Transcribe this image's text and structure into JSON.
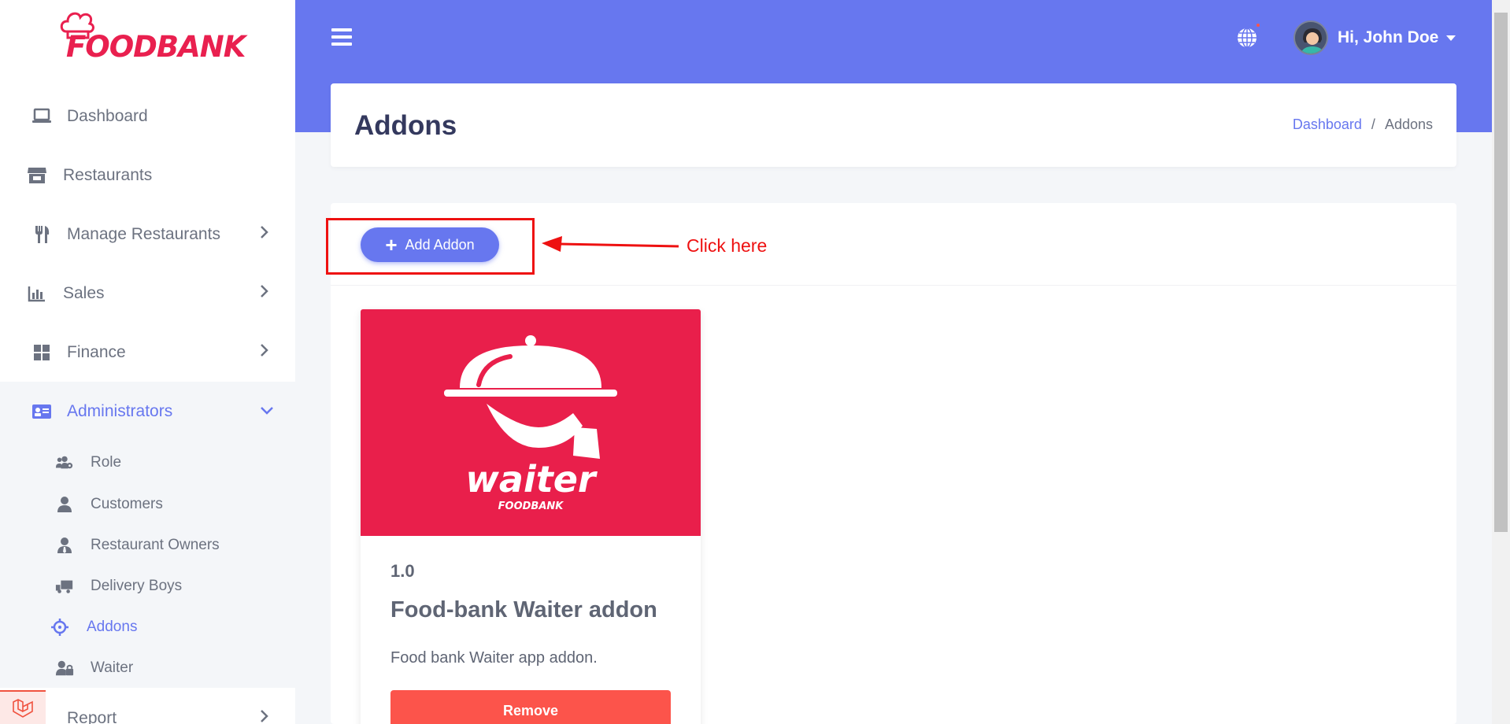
{
  "brand": {
    "name": "FOODBANK"
  },
  "sidebar": {
    "items": [
      {
        "label": "Dashboard",
        "icon": "laptop-icon"
      },
      {
        "label": "Restaurants",
        "icon": "store-icon"
      },
      {
        "label": "Manage Restaurants",
        "icon": "utensils-icon"
      },
      {
        "label": "Sales",
        "icon": "chart-icon"
      },
      {
        "label": "Finance",
        "icon": "grid-icon"
      },
      {
        "label": "Administrators",
        "icon": "id-card-icon"
      },
      {
        "label": "Report",
        "icon": "report-icon"
      }
    ],
    "submenu": [
      {
        "label": "Role",
        "icon": "users-cog-icon"
      },
      {
        "label": "Customers",
        "icon": "user-icon"
      },
      {
        "label": "Restaurant Owners",
        "icon": "user-tie-icon"
      },
      {
        "label": "Delivery Boys",
        "icon": "truck-icon"
      },
      {
        "label": "Addons",
        "icon": "crosshairs-icon"
      },
      {
        "label": "Waiter",
        "icon": "user-lock-icon"
      }
    ]
  },
  "header": {
    "user_greeting": "Hi, John Doe"
  },
  "page": {
    "title": "Addons",
    "breadcrumb": {
      "home": "Dashboard",
      "separator": "/",
      "current": "Addons"
    }
  },
  "toolbar": {
    "add_label": "Add Addon"
  },
  "annotation": {
    "text": "Click here"
  },
  "addons": [
    {
      "image_text": "waiter",
      "image_subtext": "FOODBANK",
      "version": "1.0",
      "title": "Food-bank Waiter addon",
      "description": "Food bank Waiter app addon.",
      "remove_label": "Remove"
    }
  ],
  "colors": {
    "primary": "#6777ef",
    "brand": "#e91f4b",
    "danger": "#fc544b",
    "annotation": "#ee1111"
  }
}
